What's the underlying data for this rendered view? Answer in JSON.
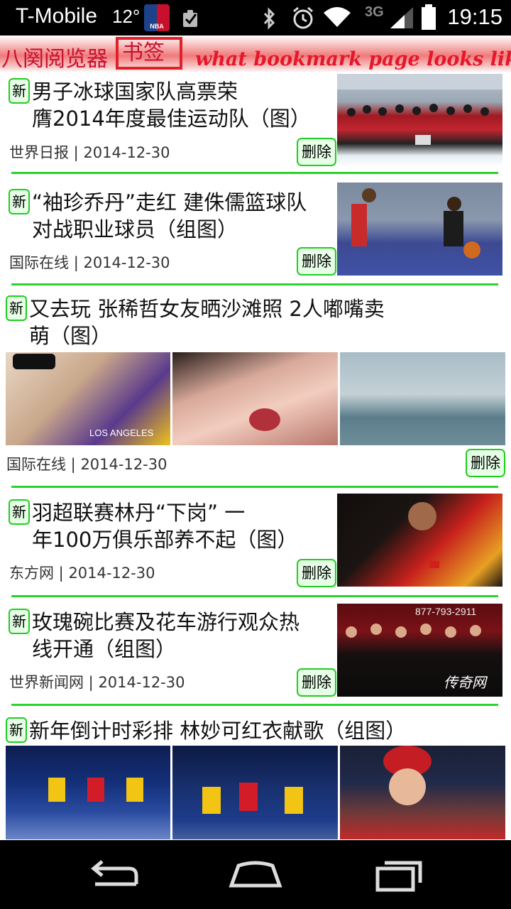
{
  "status_bar": {
    "carrier": "T-Mobile",
    "temperature": "12°",
    "nba_logo": "NBA",
    "network": "3G",
    "time": "19:15",
    "icons": [
      "nba-icon",
      "checkbox-icon",
      "bluetooth-icon",
      "alarm-icon",
      "wifi-icon",
      "signal-icon",
      "battery-icon"
    ]
  },
  "header": {
    "app_title": "八阕阅览器",
    "tab_label": "书签",
    "caption": "what bookmark page looks like"
  },
  "articles": [
    {
      "badge": "新",
      "title_line1": "男子冰球国家队高票荣",
      "title_line2": "膺2014年度最佳运动队（图）",
      "source": "世界日报",
      "date": "2014-12-30",
      "delete": "删除"
    },
    {
      "badge": "新",
      "title_line1": "“袖珍乔丹”走红 建侏儒篮球队",
      "title_line2": "对战职业球员（组图）",
      "source": "国际在线 ",
      "date": "2014-12-30",
      "delete": "删除"
    },
    {
      "badge": "新",
      "title_line1": "又去玩 张稀哲女友晒沙滩照 2人嘟嘴卖",
      "title_line2": "萌（图）",
      "source": "国际在线",
      "date": "2014-12-30",
      "delete": "删除"
    },
    {
      "badge": "新",
      "title_line1": "羽超联赛林丹“下岗” 一",
      "title_line2": "年100万俱乐部养不起（图）",
      "source": "东方网",
      "date": "2014-12-30",
      "delete": "删除"
    },
    {
      "badge": "新",
      "title_line1": "玫瑰碗比赛及花车游行观众热",
      "title_line2": "线开通（组图）",
      "source": "世界新闻网",
      "date": "2014-12-30",
      "delete": "删除"
    },
    {
      "badge": "新",
      "title_line1": "新年倒计时彩排 林妙可红衣献歌（组图）",
      "title_line2": "",
      "source": "",
      "date": "",
      "delete": ""
    }
  ],
  "photo_texts": {
    "jersey": "LOS ANGELES",
    "phone_number": "877-793-2911",
    "watermark": "传奇网"
  },
  "separator": " | ",
  "colors": {
    "accent_green": "#2ad42a",
    "header_red": "#c8102e",
    "caption_red": "#e3182a"
  }
}
